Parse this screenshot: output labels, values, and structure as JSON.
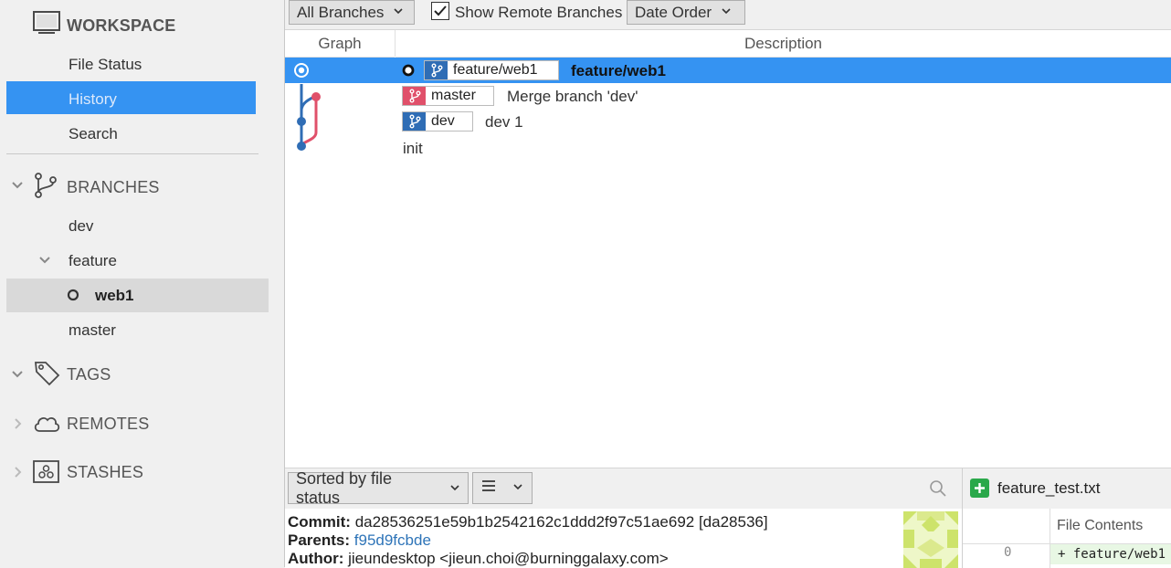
{
  "sidebar": {
    "workspace": {
      "title": "WORKSPACE",
      "items": [
        "File Status",
        "History",
        "Search"
      ],
      "selected": "History"
    },
    "branches": {
      "title": "BRANCHES",
      "items": [
        "dev",
        "feature",
        "web1",
        "master"
      ],
      "current": "web1"
    },
    "tags": {
      "title": "TAGS"
    },
    "remotes": {
      "title": "REMOTES"
    },
    "stashes": {
      "title": "STASHES"
    }
  },
  "toolbar": {
    "branch_filter": "All Branches",
    "show_remote_label": "Show Remote Branches",
    "show_remote_checked": true,
    "order": "Date Order"
  },
  "graph": {
    "col_graph": "Graph",
    "col_description": "Description",
    "rows": [
      {
        "branch": "feature/web1",
        "message": "feature/web1",
        "color": "#2f6db5",
        "selected": true
      },
      {
        "branch": "master",
        "message": "Merge branch 'dev'",
        "color": "#e0506a"
      },
      {
        "branch": "dev",
        "message": "dev 1",
        "color": "#2f6db5"
      },
      {
        "branch": "",
        "message": "init"
      }
    ]
  },
  "details": {
    "sort": "Sorted by file status",
    "commit_label": "Commit:",
    "commit": "da28536251e59b1b2542162c1ddd2f97c51ae692 [da28536]",
    "parents_label": "Parents:",
    "parents": "f95d9fcbde",
    "author_label": "Author:",
    "author": "jieundesktop <jieun.choi@burninggalaxy.com>"
  },
  "file": {
    "name": "feature_test.txt",
    "contents_label": "File Contents",
    "line_no": "0",
    "line": "+ feature/web1"
  },
  "colors": {
    "accent": "#3593f2",
    "master": "#e0506a",
    "branch": "#2f6db5",
    "added": "#2aa84a"
  }
}
